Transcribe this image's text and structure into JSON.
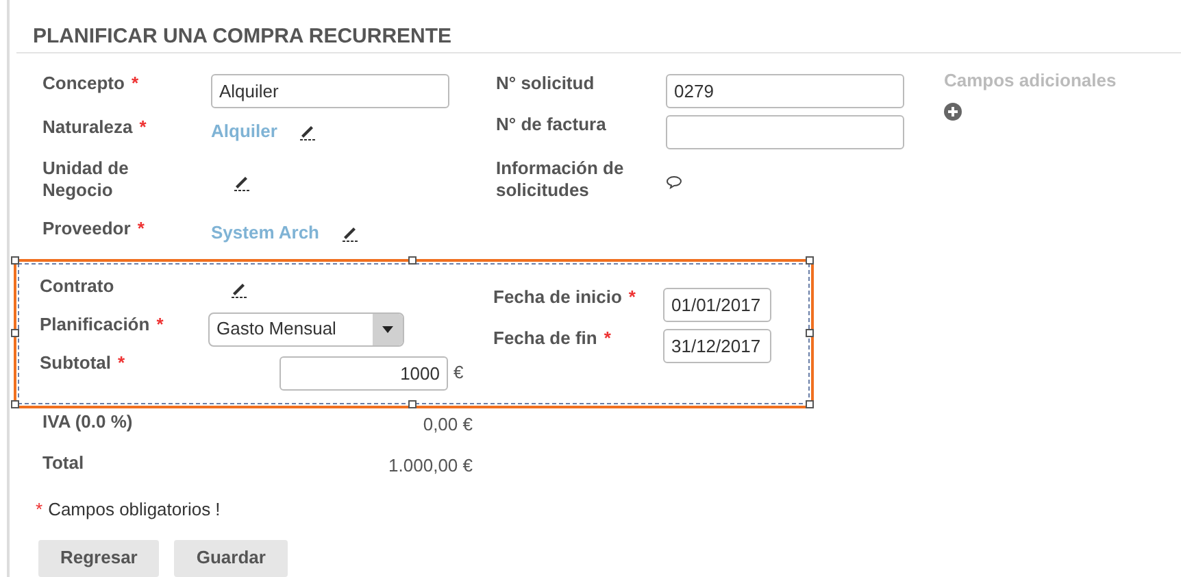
{
  "title": "PLANIFICAR UNA COMPRA RECURRENTE",
  "required_mark": "*",
  "left_fields": [
    {
      "kind": "input",
      "label": "Concepto",
      "required": true,
      "value": "Alquiler"
    },
    {
      "kind": "link",
      "label": "Naturaleza",
      "required": true,
      "value": "Alquiler"
    },
    {
      "kind": "edit",
      "label": "Unidad de Negocio",
      "required": false
    },
    {
      "kind": "link",
      "label": "Proveedor",
      "required": true,
      "value": "System Arch"
    }
  ],
  "right_fields": [
    {
      "kind": "input",
      "label": "N° solicitud",
      "required": false,
      "value": "0279"
    },
    {
      "kind": "input",
      "label": "N° de factura",
      "required": false
    },
    {
      "kind": "comment",
      "label": "Información de solicitudes",
      "required": false
    }
  ],
  "extra": {
    "label": "Campos adicionales"
  },
  "section": {
    "selected": true,
    "left_fields": [
      {
        "kind": "edit",
        "label": "Contrato",
        "required": false
      },
      {
        "kind": "select",
        "label": "Planificación",
        "required": true,
        "value": "Gasto Mensual"
      },
      {
        "kind": "amount",
        "label": "Subtotal",
        "required": true,
        "value": "1000",
        "unit": "€"
      }
    ],
    "right_fields": [
      {
        "kind": "date",
        "label": "Fecha de inicio",
        "required": true,
        "value": "01/01/2017"
      },
      {
        "kind": "date",
        "label": "Fecha de fin",
        "required": true,
        "value": "31/12/2017"
      }
    ]
  },
  "totals": [
    {
      "label": "IVA (0.0 %)",
      "value": "0,00 €"
    },
    {
      "label": "Total",
      "value": "1.000,00 €"
    }
  ],
  "required_note": "Campos obligatorios !",
  "buttons": [
    "Regresar",
    "Guardar"
  ]
}
